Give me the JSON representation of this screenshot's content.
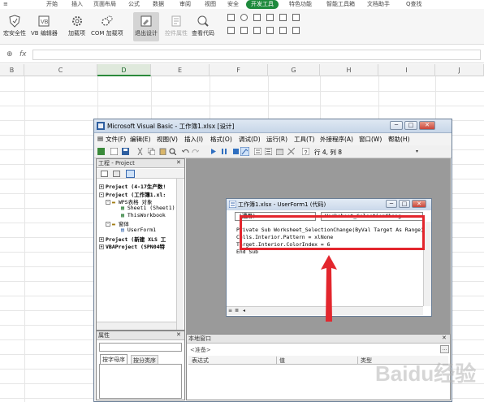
{
  "ribbon": {
    "tabs": [
      "开始",
      "插入",
      "页面布局",
      "公式",
      "数据",
      "审阅",
      "视图",
      "安全",
      "开发工具",
      "特色功能",
      "智能工具箱",
      "文档助手",
      "Q查找"
    ],
    "active_tab": "开发工具",
    "buttons": [
      "宏安全性",
      "VB 编辑器",
      "加载项",
      "COM 加载项",
      "退出设计",
      "控件属性",
      "查看代码"
    ]
  },
  "formula_bar": {
    "fx": "fx"
  },
  "columns": [
    "B",
    "C",
    "D",
    "E",
    "F",
    "G",
    "H",
    "I",
    "J"
  ],
  "selected_column": "D",
  "vbe": {
    "title": "Microsoft Visual Basic - 工作簿1.xlsx [设计]",
    "menu": [
      "文件(F)",
      "编辑(E)",
      "视图(V)",
      "插入(I)",
      "格式(O)",
      "调试(D)",
      "运行(R)",
      "工具(T)",
      "外接程序(A)",
      "窗口(W)",
      "帮助(H)"
    ],
    "position": "行 4, 列 8",
    "project_title": "工程 - Project",
    "tree": [
      "Project (4-17生产数!",
      "Project (工作簿1.xl:",
      "WPS表格 对象",
      "Sheet1 (Sheet1)",
      "ThisWorkbook",
      "窗体",
      "UserForm1",
      "Project (新建 XLS 工",
      "VBAProject (SPN04特"
    ],
    "properties_title": "属性",
    "props_tabs": [
      "按字母序",
      "按分类序"
    ],
    "code_window": {
      "title": "工作簿1.xlsx - UserForm1 (代码)",
      "combo_left": "(通用)",
      "combo_right": "Worksheet_SelectionChang",
      "lines": [
        "Private Sub Worksheet_SelectionChange(ByVal Target As Range)",
        "Cells.Interior.Pattern = xlNone",
        "Target.Interior.ColorIndex = 6",
        "End Sub"
      ]
    },
    "immediate": {
      "title": "本地窗口",
      "hint": "<准备>",
      "headers": [
        "表达式",
        "值",
        "类型"
      ]
    }
  },
  "watermark": "Baidu经验"
}
